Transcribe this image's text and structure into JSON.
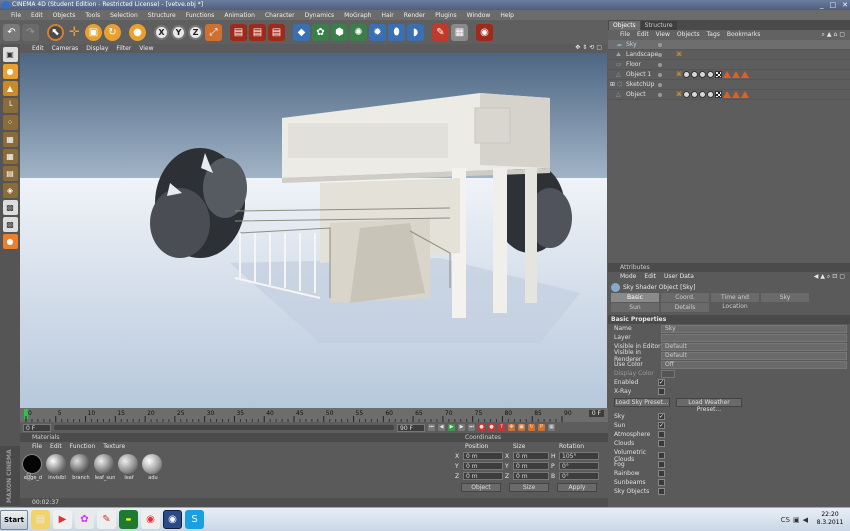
{
  "window": {
    "title": "CINEMA 4D (Student Edition - Restricted License) - [vetve.obj *]",
    "controls": [
      "_",
      "□",
      "✕"
    ]
  },
  "menu": [
    "File",
    "Edit",
    "Objects",
    "Tools",
    "Selection",
    "Structure",
    "Functions",
    "Animation",
    "Character",
    "Dynamics",
    "MoGraph",
    "Hair",
    "Render",
    "Plugins",
    "Window",
    "Help"
  ],
  "viewport": {
    "menu": [
      "Edit",
      "Cameras",
      "Display",
      "Filter",
      "View"
    ]
  },
  "timeline": {
    "ticks": [
      "0",
      "5",
      "10",
      "15",
      "20",
      "25",
      "30",
      "35",
      "40",
      "45",
      "50",
      "55",
      "60",
      "65",
      "70",
      "75",
      "80",
      "85",
      "90"
    ],
    "end_label": "0 F",
    "start_field": "0 F",
    "end_field": "90 F"
  },
  "materials": {
    "header": "Materials",
    "menu": [
      "File",
      "Edit",
      "Function",
      "Texture"
    ],
    "items": [
      "edge_d",
      "invisibl",
      "branch",
      "leaf_sun",
      "leaf",
      "adu"
    ]
  },
  "coordinates": {
    "header": "Coordinates",
    "cols": [
      "Position",
      "Size",
      "Rotation"
    ],
    "rows": [
      {
        "axis": "X",
        "pos": "0 m",
        "size": "0 m",
        "rlabel": "H",
        "rot": "105°"
      },
      {
        "axis": "Y",
        "pos": "0 m",
        "size": "0 m",
        "rlabel": "P",
        "rot": "0°"
      },
      {
        "axis": "Z",
        "pos": "0 m",
        "size": "0 m",
        "rlabel": "B",
        "rot": "0°"
      }
    ],
    "mode": "Object",
    "size_mode": "Size",
    "apply": "Apply"
  },
  "status": {
    "time": "00:02:37"
  },
  "objects_panel": {
    "tabs": [
      "Objects",
      "Structure"
    ],
    "menu": [
      "File",
      "Edit",
      "View",
      "Objects",
      "Tags",
      "Bookmarks"
    ],
    "items": [
      {
        "name": "Sky"
      },
      {
        "name": "Landscape"
      },
      {
        "name": "Floor"
      },
      {
        "name": "Object 1"
      },
      {
        "name": "SketchUp"
      },
      {
        "name": "Object"
      }
    ]
  },
  "attributes": {
    "header": "Attributes",
    "menu": [
      "Mode",
      "Edit",
      "User Data"
    ],
    "object_title": "Sky Shader Object [Sky]",
    "tabs1": [
      "Basic",
      "Coord.",
      "Time and Location",
      "Sky"
    ],
    "tabs2": [
      "Sun",
      "Details"
    ],
    "section": "Basic Properties",
    "fields": [
      {
        "label": "Name",
        "value": "Sky"
      },
      {
        "label": "Layer",
        "value": ""
      },
      {
        "label": "Visible in Editor",
        "value": "Default"
      },
      {
        "label": "Visible in Renderer",
        "value": "Default"
      },
      {
        "label": "Use Color",
        "value": "Off"
      },
      {
        "label": "Display Color",
        "value": ""
      }
    ],
    "checks": [
      {
        "label": "Enabled",
        "on": "✓"
      },
      {
        "label": "X-Ray",
        "on": ""
      }
    ],
    "buttons": [
      "Load Sky Preset...",
      "Load Weather Preset..."
    ],
    "sky_checks": [
      {
        "label": "Sky",
        "on": "✓"
      },
      {
        "label": "Sun",
        "on": "✓"
      },
      {
        "label": "Atmosphere",
        "on": ""
      },
      {
        "label": "Clouds",
        "on": ""
      },
      {
        "label": "Volumetric Clouds",
        "on": ""
      },
      {
        "label": "Fog",
        "on": ""
      },
      {
        "label": "Rainbow",
        "on": ""
      },
      {
        "label": "Sunbeams",
        "on": ""
      },
      {
        "label": "Sky Objects",
        "on": ""
      }
    ]
  },
  "taskbar": {
    "start": "Start",
    "lang": "CS",
    "time": "22:20",
    "date": "8.3.2011"
  }
}
